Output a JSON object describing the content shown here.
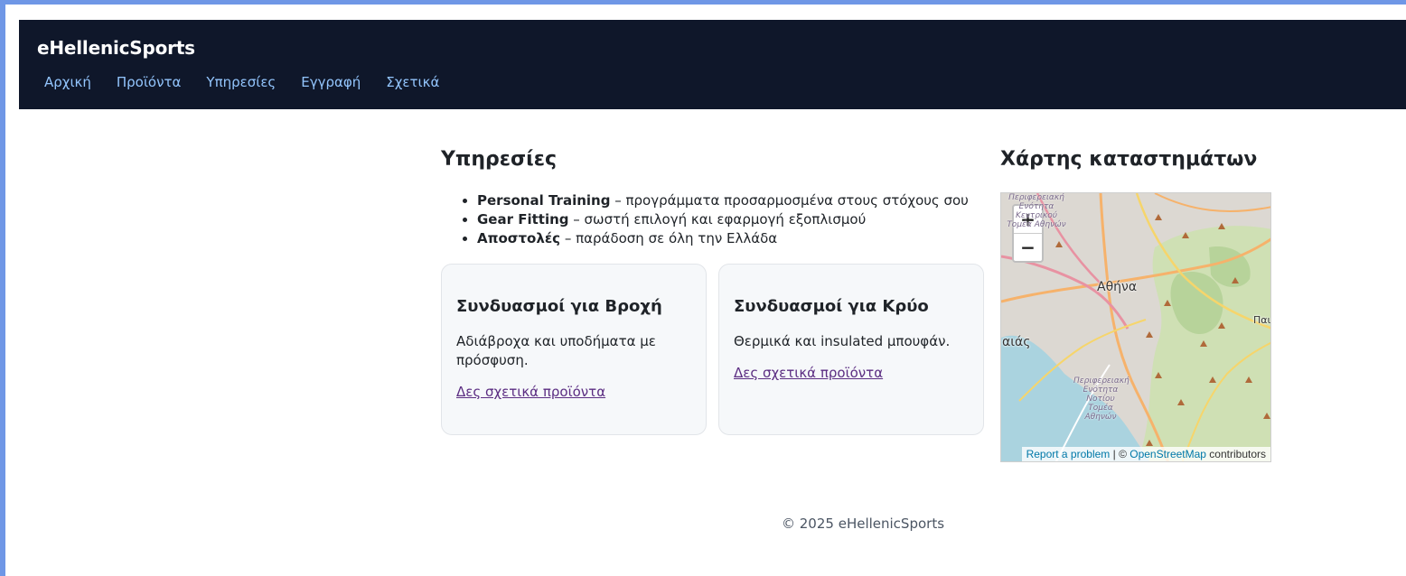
{
  "site": {
    "brand": "eHellenicSports"
  },
  "nav": {
    "items": [
      {
        "label": "Αρχική"
      },
      {
        "label": "Προϊόντα"
      },
      {
        "label": "Υπηρεσίες"
      },
      {
        "label": "Εγγραφή"
      },
      {
        "label": "Σχετικά"
      }
    ]
  },
  "services": {
    "title": "Υπηρεσίες",
    "items": [
      {
        "name": "Personal Training",
        "desc": " – προγράμματα προσαρμοσμένα στους στόχους σου"
      },
      {
        "name": "Gear Fitting",
        "desc": " – σωστή επιλογή και εφαρμογή εξοπλισμού"
      },
      {
        "name": "Αποστολές",
        "desc": " – παράδοση σε όλη την Ελλάδα"
      }
    ]
  },
  "cards": [
    {
      "title": "Συνδυασμοί για Βροχή",
      "text": "Αδιάβροχα και υποδήματα με πρόσφυση.",
      "link": "Δες σχετικά προϊόντα"
    },
    {
      "title": "Συνδυασμοί για Κρύο",
      "text": "Θερμικά και insulated μπουφάν.",
      "link": "Δες σχετικά προϊόντα"
    }
  ],
  "map": {
    "title": "Χάρτης καταστημάτων",
    "zoom_in": "+",
    "zoom_out": "−",
    "labels": {
      "city": "Αθήνα",
      "left_edge": "αιάς",
      "right_edge": "Παι",
      "unit_bottom": "Περιφερειακή Ενότητα Νοτίου Τομέα Αθηνών",
      "unit_top": "Περιφερειακή Ενότητα Κεντρικού Τομέα Αθηνών"
    },
    "attribution": {
      "report": "Report a problem",
      "sep": " | © ",
      "osm": "OpenStreetMap",
      "suffix": " contributors"
    }
  },
  "footer": {
    "text": "© 2025 eHellenicSports"
  }
}
